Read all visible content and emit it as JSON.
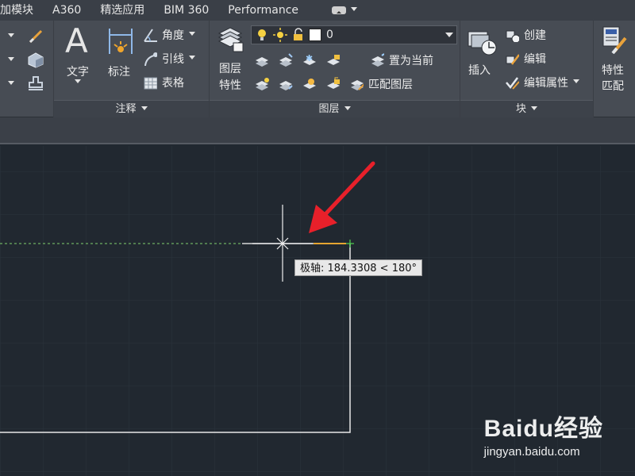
{
  "tabs": [
    "加模块",
    "A360",
    "精选应用",
    "BIM 360",
    "Performance"
  ],
  "ribbon": {
    "annotation": {
      "title": "注释",
      "text_label": "文字",
      "dimension_label": "标注",
      "angle_label": "角度",
      "leader_label": "引线",
      "table_label": "表格"
    },
    "layers": {
      "title": "图层",
      "properties_label_1": "图层",
      "properties_label_2": "特性",
      "current_layer": "0",
      "set_current_label": "置为当前",
      "match_layer_label": "匹配图层"
    },
    "block": {
      "title": "块",
      "insert_label": "插入",
      "create_label": "创建",
      "edit_label": "编辑",
      "edit_attributes_label": "编辑属性"
    },
    "properties": {
      "match_label_1": "特性",
      "match_label_2": "匹配"
    }
  },
  "canvas": {
    "tooltip": "极轴: 184.3308 < 180°",
    "background": "#212830",
    "grid_color": "#2b333d",
    "arrow_color": "#e8202a",
    "tracking_color": "#7fd16e"
  },
  "watermark": {
    "main": "Baidu经验",
    "sub": "jingyan.baidu.com"
  }
}
